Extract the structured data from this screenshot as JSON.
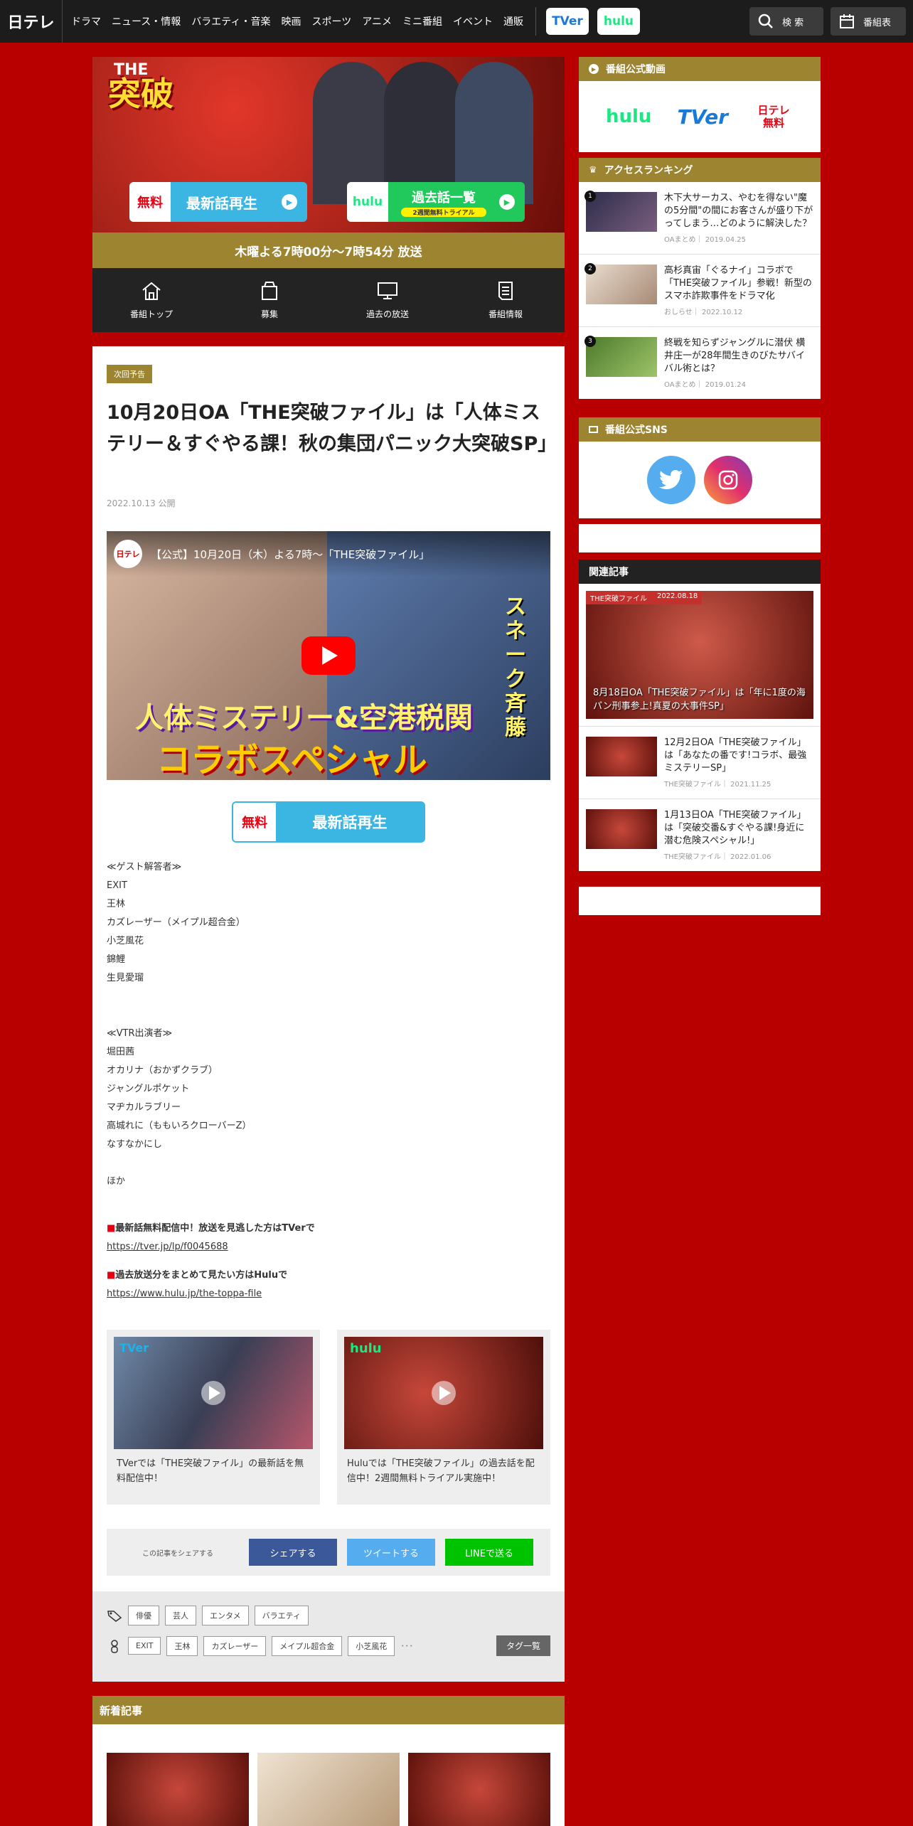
{
  "header": {
    "logo": "日テレ",
    "nav": [
      "ドラマ",
      "ニュース・情報",
      "バラエティ・音楽",
      "映画",
      "スポーツ",
      "アニメ",
      "ミニ番組",
      "イベント",
      "通販"
    ],
    "tver": "TVer",
    "hulu": "hulu",
    "search": "検 索",
    "schedule": "番組表"
  },
  "hero": {
    "logo_main": "突破",
    "logo_sub": "THE",
    "free": "無料",
    "latest": "最新話再生",
    "hulu": "hulu",
    "past": "過去話一覧",
    "trial": "2週間無料トライアル",
    "airtime": "木曜よる7時00分～7時54分 放送"
  },
  "program_nav": [
    "番組トップ",
    "募集",
    "過去の放送",
    "番組情報"
  ],
  "article": {
    "badge": "次回予告",
    "title": "10月20日OA「THE突破ファイル」は「人体ミステリー＆すぐやる課！秋の集団パニック大突破SP」",
    "date": "2022.10.13 公開",
    "video": {
      "channel": "日テレ",
      "title": "【公式】10月20日（木）よる7時～「THE突破ファイル」",
      "cap1": "人体ミステリー&空港税関",
      "cap2": "コラボスペシャル",
      "cap3": "スネーク斉藤"
    },
    "free": "無料",
    "latest": "最新話再生",
    "guest_heading": "≪ゲスト解答者≫",
    "guests": [
      "EXIT",
      "王林",
      "カズレーザー（メイプル超合金）",
      "小芝風花",
      "錦鯉",
      "生見愛瑠"
    ],
    "vtr_heading": "≪VTR出演者≫",
    "vtr": [
      "堀田茜",
      "オカリナ（おかずクラブ）",
      "ジャングルポケット",
      "マヂカルラブリー",
      "高城れに（ももいろクローバーZ）",
      "なすなかにし"
    ],
    "other": "ほか",
    "tver_heading": "最新話無料配信中！放送を見逃した方はTVerで",
    "tver_url": "https://tver.jp/lp/f0045688",
    "hulu_heading": "過去放送分をまとめて見たい方はHuluで",
    "hulu_url": "https://www.hulu.jp/the-toppa-file",
    "cards": [
      {
        "brand": "TVer",
        "text": "TVerでは「THE突破ファイル」の最新話を無料配信中！"
      },
      {
        "brand": "hulu",
        "text": "Huluでは「THE突破ファイル」の過去話を配信中！2週間無料トライアル実施中！"
      }
    ],
    "share_label": "この記事をシェアする",
    "share": [
      "シェアする",
      "ツイートする",
      "LINEで送る"
    ],
    "genre_tags": [
      "俳優",
      "芸人",
      "エンタメ",
      "バラエティ"
    ],
    "person_tags": [
      "EXIT",
      "王林",
      "カズレーザー",
      "メイプル超合金",
      "小芝風花"
    ],
    "more": "･･･",
    "tag_list": "タグ一覧"
  },
  "new_articles": "新着記事",
  "sidebar": {
    "official_video": "番組公式動画",
    "logos": [
      "hulu",
      "TVer",
      "日テレ無料"
    ],
    "ranking_title": "アクセスランキング",
    "ranking": [
      {
        "rank": "1",
        "title": "木下大サーカス、やむを得ない\"魔の5分間\"の間にお客さんが盛り下がってしまう…どのように解決した？",
        "meta": "OAまとめ｜ 2019.04.25"
      },
      {
        "rank": "2",
        "title": "高杉真宙「ぐるナイ」コラボで「THE突破ファイル」参戦！新型のスマホ詐欺事件をドラマ化",
        "meta": "おしらせ｜ 2022.10.12"
      },
      {
        "rank": "3",
        "title": "終戦を知らずジャングルに潜伏 横井庄一が28年間生きのびたサバイバル術とは？",
        "meta": "OAまとめ｜ 2019.01.24"
      }
    ],
    "sns_title": "番組公式SNS",
    "related_title": "関連記事",
    "related_main": {
      "tag": "THE突破ファイル",
      "date": "2022.08.18",
      "title": "8月18日OA「THE突破ファイル」は「年に1度の海パン刑事参上!真夏の大事件SP」"
    },
    "related": [
      {
        "title": "12月2日OA「THE突破ファイル」は「あなたの番です!コラボ、最強ミステリーSP」",
        "meta": "THE突破ファイル｜ 2021.11.25"
      },
      {
        "title": "1月13日OA「THE突破ファイル」は「突破交番&すぐやる課!身近に潜む危険スペシャル!」",
        "meta": "THE突破ファイル｜ 2022.01.06"
      }
    ]
  },
  "colors": {
    "accent": "#9c8431",
    "background": "#b90000",
    "tver_blue": "#3bb6e3",
    "hulu_green": "#1ce783"
  }
}
